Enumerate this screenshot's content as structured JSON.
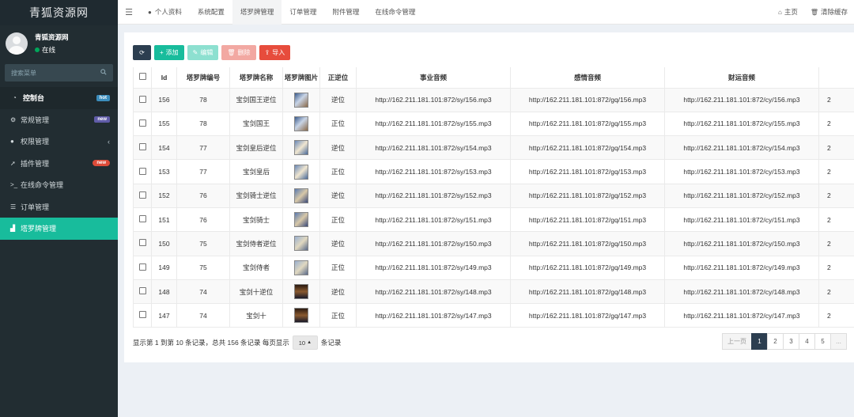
{
  "sidebar": {
    "logo": "青狐资源网",
    "user_name": "青狐资源网",
    "user_status": "在线",
    "search_placeholder": "搜索菜单",
    "items": [
      {
        "label": "控制台",
        "badge": "hot"
      },
      {
        "label": "常规管理",
        "badge": "new"
      },
      {
        "label": "权限管理",
        "badge": ""
      },
      {
        "label": "插件管理",
        "badge": "new"
      },
      {
        "label": "在线命令管理",
        "badge": ""
      },
      {
        "label": "订单管理",
        "badge": ""
      },
      {
        "label": "塔罗牌管理",
        "badge": ""
      }
    ]
  },
  "topnav": {
    "tabs": [
      "个人资料",
      "系统配置",
      "塔罗牌管理",
      "订单管理",
      "附件管理",
      "在线命令管理"
    ],
    "home": "主页",
    "clear_cache": "清除缓存"
  },
  "toolbar": {
    "add": "添加",
    "edit": "编辑",
    "delete": "删除",
    "import": "导入"
  },
  "table": {
    "headers": [
      "Id",
      "塔罗牌编号",
      "塔罗牌名称",
      "塔罗牌图片",
      "正逆位",
      "事业音频",
      "感情音频",
      "财运音频"
    ],
    "rows": [
      {
        "id": "156",
        "num": "78",
        "name": "宝剑国王逆位",
        "pos": "逆位",
        "sy": "http://162.211.181.101:872/sy/156.mp3",
        "gq": "http://162.211.181.101:872/gq/156.mp3",
        "cy": "http://162.211.181.101:872/cy/156.mp3",
        "extra": "2"
      },
      {
        "id": "155",
        "num": "78",
        "name": "宝剑国王",
        "pos": "正位",
        "sy": "http://162.211.181.101:872/sy/155.mp3",
        "gq": "http://162.211.181.101:872/gq/155.mp3",
        "cy": "http://162.211.181.101:872/cy/155.mp3",
        "extra": "2"
      },
      {
        "id": "154",
        "num": "77",
        "name": "宝剑皇后逆位",
        "pos": "逆位",
        "sy": "http://162.211.181.101:872/sy/154.mp3",
        "gq": "http://162.211.181.101:872/gq/154.mp3",
        "cy": "http://162.211.181.101:872/cy/154.mp3",
        "extra": "2"
      },
      {
        "id": "153",
        "num": "77",
        "name": "宝剑皇后",
        "pos": "正位",
        "sy": "http://162.211.181.101:872/sy/153.mp3",
        "gq": "http://162.211.181.101:872/gq/153.mp3",
        "cy": "http://162.211.181.101:872/cy/153.mp3",
        "extra": "2"
      },
      {
        "id": "152",
        "num": "76",
        "name": "宝剑骑士逆位",
        "pos": "逆位",
        "sy": "http://162.211.181.101:872/sy/152.mp3",
        "gq": "http://162.211.181.101:872/gq/152.mp3",
        "cy": "http://162.211.181.101:872/cy/152.mp3",
        "extra": "2"
      },
      {
        "id": "151",
        "num": "76",
        "name": "宝剑骑士",
        "pos": "正位",
        "sy": "http://162.211.181.101:872/sy/151.mp3",
        "gq": "http://162.211.181.101:872/gq/151.mp3",
        "cy": "http://162.211.181.101:872/cy/151.mp3",
        "extra": "2"
      },
      {
        "id": "150",
        "num": "75",
        "name": "宝剑侍者逆位",
        "pos": "逆位",
        "sy": "http://162.211.181.101:872/sy/150.mp3",
        "gq": "http://162.211.181.101:872/gq/150.mp3",
        "cy": "http://162.211.181.101:872/cy/150.mp3",
        "extra": "2"
      },
      {
        "id": "149",
        "num": "75",
        "name": "宝剑侍者",
        "pos": "正位",
        "sy": "http://162.211.181.101:872/sy/149.mp3",
        "gq": "http://162.211.181.101:872/gq/149.mp3",
        "cy": "http://162.211.181.101:872/cy/149.mp3",
        "extra": "2"
      },
      {
        "id": "148",
        "num": "74",
        "name": "宝剑十逆位",
        "pos": "逆位",
        "sy": "http://162.211.181.101:872/sy/148.mp3",
        "gq": "http://162.211.181.101:872/gq/148.mp3",
        "cy": "http://162.211.181.101:872/cy/148.mp3",
        "extra": "2"
      },
      {
        "id": "147",
        "num": "74",
        "name": "宝剑十",
        "pos": "正位",
        "sy": "http://162.211.181.101:872/sy/147.mp3",
        "gq": "http://162.211.181.101:872/gq/147.mp3",
        "cy": "http://162.211.181.101:872/cy/147.mp3",
        "extra": "2"
      }
    ]
  },
  "footer": {
    "info_prefix": "显示第 1 到第 10 条记录，总共 156 条记录 每页显示",
    "page_size": "10",
    "info_suffix": "条记录",
    "pager": [
      "上一页",
      "1",
      "2",
      "3",
      "4",
      "5",
      "..."
    ]
  },
  "colors": {
    "sidebar_bg": "#222d32",
    "accent": "#18bc9c",
    "danger": "#e74c3c",
    "dark": "#2c3e50"
  }
}
